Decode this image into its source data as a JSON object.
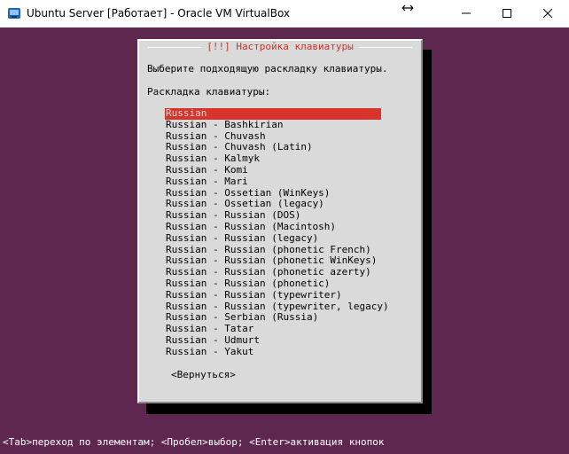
{
  "window": {
    "title": "Ubuntu Server [Работает] - Oracle VM VirtualBox",
    "icons": {
      "app": "virtualbox-icon",
      "resize": "resize-arrows-icon",
      "minimize": "minimize-icon",
      "maximize": "maximize-icon",
      "close": "close-icon"
    }
  },
  "colors": {
    "screen_background": "#5e2750",
    "dialog_background": "#dadada",
    "title_text": "#c0392b",
    "selection": "#d9342b",
    "status_text": "#ffffff"
  },
  "dialog": {
    "title": "[!!] Настройка клавиатуры",
    "prompt": "Выберите подходящую раскладку клавиатуры.",
    "field_label": "Раскладка клавиатуры:",
    "selected_index": 0,
    "layouts": [
      "Russian",
      "Russian - Bashkirian",
      "Russian - Chuvash",
      "Russian - Chuvash (Latin)",
      "Russian - Kalmyk",
      "Russian - Komi",
      "Russian - Mari",
      "Russian - Ossetian (WinKeys)",
      "Russian - Ossetian (legacy)",
      "Russian - Russian (DOS)",
      "Russian - Russian (Macintosh)",
      "Russian - Russian (legacy)",
      "Russian - Russian (phonetic French)",
      "Russian - Russian (phonetic WinKeys)",
      "Russian - Russian (phonetic azerty)",
      "Russian - Russian (phonetic)",
      "Russian - Russian (typewriter)",
      "Russian - Russian (typewriter, legacy)",
      "Russian - Serbian (Russia)",
      "Russian - Tatar",
      "Russian - Udmurt",
      "Russian - Yakut"
    ],
    "back_button": "<Вернуться>"
  },
  "status_bar": "<Tab>переход по элементам; <Пробел>выбор; <Enter>активация кнопок"
}
